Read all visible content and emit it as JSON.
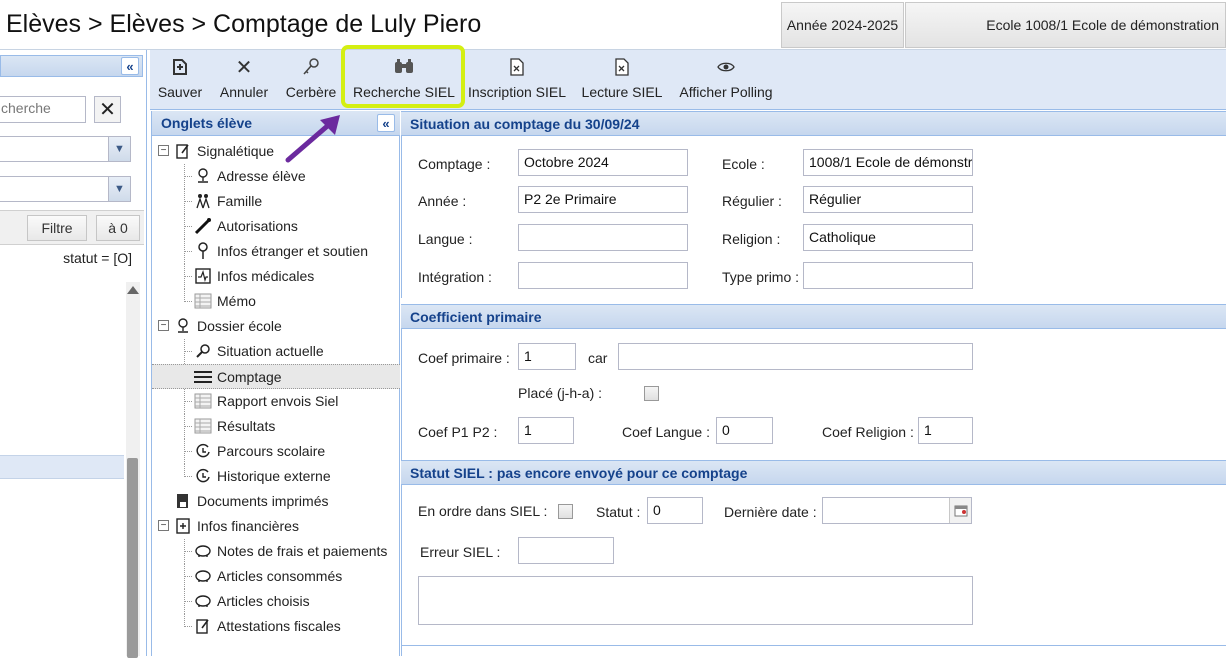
{
  "header": {
    "breadcrumb": "Elèves > Elèves > Comptage de Luly Piero",
    "year": "Année 2024-2025",
    "school": "Ecole 1008/1 Ecole de démonstration"
  },
  "left_panel": {
    "search_placeholder": "cherche",
    "filter_label": "Filtre",
    "reset_label": "à 0",
    "status_text": "statut = [O]"
  },
  "toolbar": {
    "buttons": [
      {
        "label": "Sauver",
        "icon": "save-icon"
      },
      {
        "label": "Annuler",
        "icon": "close-icon"
      },
      {
        "label": "Cerbère",
        "icon": "key-icon"
      },
      {
        "label": "Recherche SIEL",
        "icon": "binoculars-icon"
      },
      {
        "label": "Inscription SIEL",
        "icon": "document-icon"
      },
      {
        "label": "Lecture SIEL",
        "icon": "document-icon"
      },
      {
        "label": "Afficher Polling",
        "icon": "eye-icon"
      }
    ]
  },
  "tree": {
    "title": "Onglets élève",
    "items": [
      {
        "label": "Signalétique"
      },
      {
        "label": "Adresse élève"
      },
      {
        "label": "Famille"
      },
      {
        "label": "Autorisations"
      },
      {
        "label": "Infos étranger et soutien"
      },
      {
        "label": "Infos médicales"
      },
      {
        "label": "Mémo"
      },
      {
        "label": "Dossier école"
      },
      {
        "label": "Situation actuelle"
      },
      {
        "label": "Comptage"
      },
      {
        "label": "Rapport envois Siel"
      },
      {
        "label": "Résultats"
      },
      {
        "label": "Parcours scolaire"
      },
      {
        "label": "Historique externe"
      },
      {
        "label": "Documents imprimés"
      },
      {
        "label": "Infos financières"
      },
      {
        "label": "Notes de frais et paiements"
      },
      {
        "label": "Articles consommés"
      },
      {
        "label": "Articles choisis"
      },
      {
        "label": "Attestations fiscales"
      }
    ]
  },
  "situation": {
    "title": "Situation au comptage du 30/09/24",
    "comptage_label": "Comptage :",
    "comptage_value": "Octobre 2024",
    "ecole_label": "Ecole :",
    "ecole_value": "1008/1 Ecole de démonstr",
    "annee_label": "Année :",
    "annee_value": "P2 2e Primaire",
    "regulier_label": "Régulier :",
    "regulier_value": "Régulier",
    "langue_label": "Langue :",
    "langue_value": "",
    "religion_label": "Religion :",
    "religion_value": "Catholique",
    "integration_label": "Intégration :",
    "integration_value": "",
    "type_primo_label": "Type primo :",
    "type_primo_value": ""
  },
  "coefficient": {
    "title": "Coefficient primaire",
    "coef_label": "Coef primaire :",
    "coef_value": "1",
    "car_label": "car",
    "car_value": "",
    "place_label": "Placé (j-h-a) :",
    "p1p2_label": "Coef P1 P2 :",
    "p1p2_value": "1",
    "langue_label": "Coef Langue :",
    "langue_value": "0",
    "religion_label": "Coef Religion :",
    "religion_value": "1"
  },
  "statut": {
    "title": "Statut SIEL : pas encore envoyé pour ce comptage",
    "ordre_label": "En ordre dans SIEL :",
    "statut_label": "Statut :",
    "statut_value": "0",
    "date_label": "Dernière date :",
    "date_value": "",
    "erreur_label": "Erreur SIEL :",
    "erreur_value": "",
    "message_value": ""
  }
}
